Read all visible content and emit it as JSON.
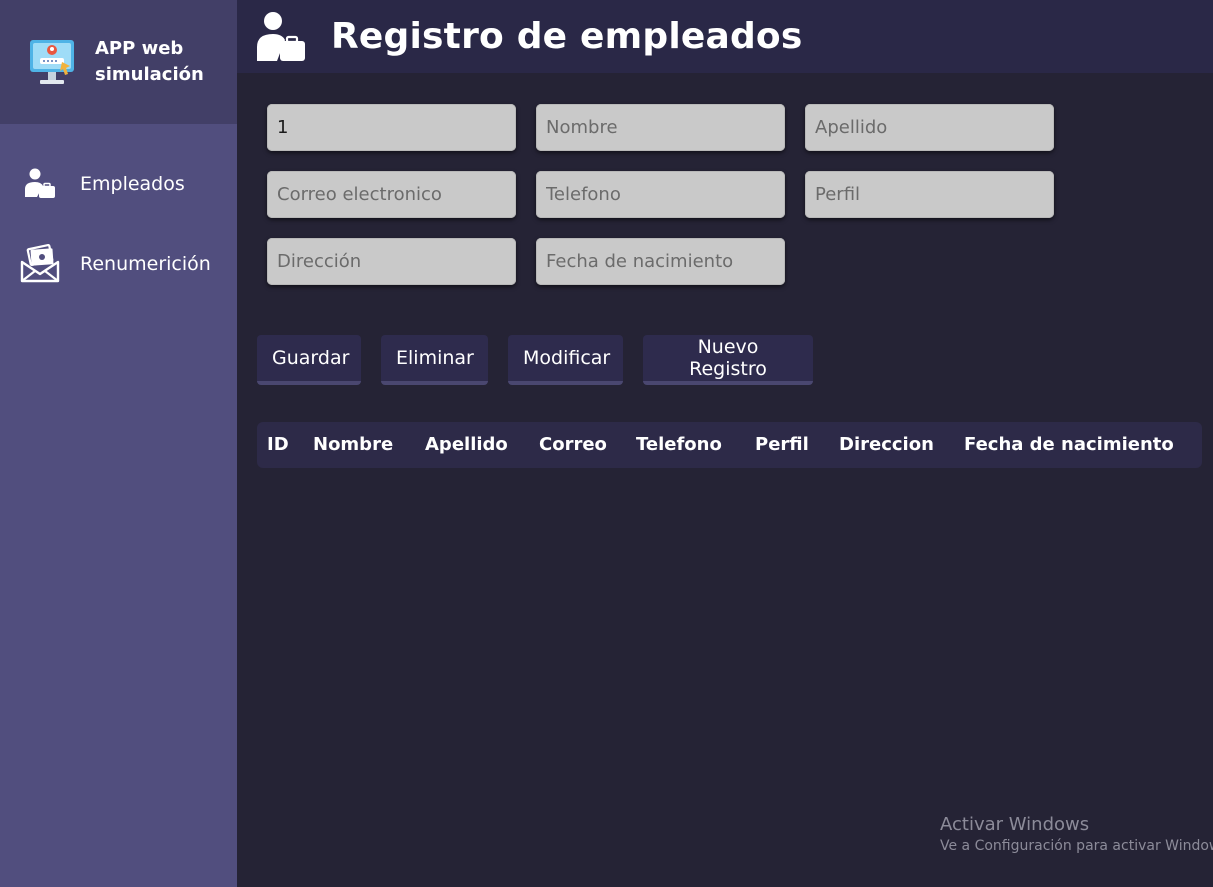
{
  "app": {
    "name": "APP web simulación"
  },
  "sidebar": {
    "items": [
      {
        "label": "Empleados",
        "icon": "employee-briefcase-icon"
      },
      {
        "label": "Renumerición",
        "icon": "money-envelope-icon"
      }
    ]
  },
  "header": {
    "title": "Registro de empleados",
    "icon": "employee-briefcase-icon"
  },
  "form": {
    "id_value": "1",
    "nombre_placeholder": "Nombre",
    "apellido_placeholder": "Apellido",
    "correo_placeholder": "Correo electronico",
    "telefono_placeholder": "Telefono",
    "perfil_placeholder": "Perfil",
    "direccion_placeholder": "Dirección",
    "fecha_placeholder": "Fecha de nacimiento"
  },
  "buttons": {
    "guardar": "Guardar",
    "eliminar": "Eliminar",
    "modificar": "Modificar",
    "nuevo": "Nuevo Registro"
  },
  "table": {
    "columns": [
      "ID",
      "Nombre",
      "Apellido",
      "Correo",
      "Telefono",
      "Perfil",
      "Direccion",
      "Fecha de nacimiento"
    ],
    "rows": []
  },
  "watermark": {
    "title": "Activar Windows",
    "subtitle": "Ve a Configuración para activar Windows."
  },
  "colors": {
    "sidebar": "#514e7e",
    "brand_bg": "#423f67",
    "header_bg": "#2a2847",
    "main_bg": "#252335",
    "field_bg": "#c9c9c9",
    "button_bg": "#2e2b4d"
  }
}
